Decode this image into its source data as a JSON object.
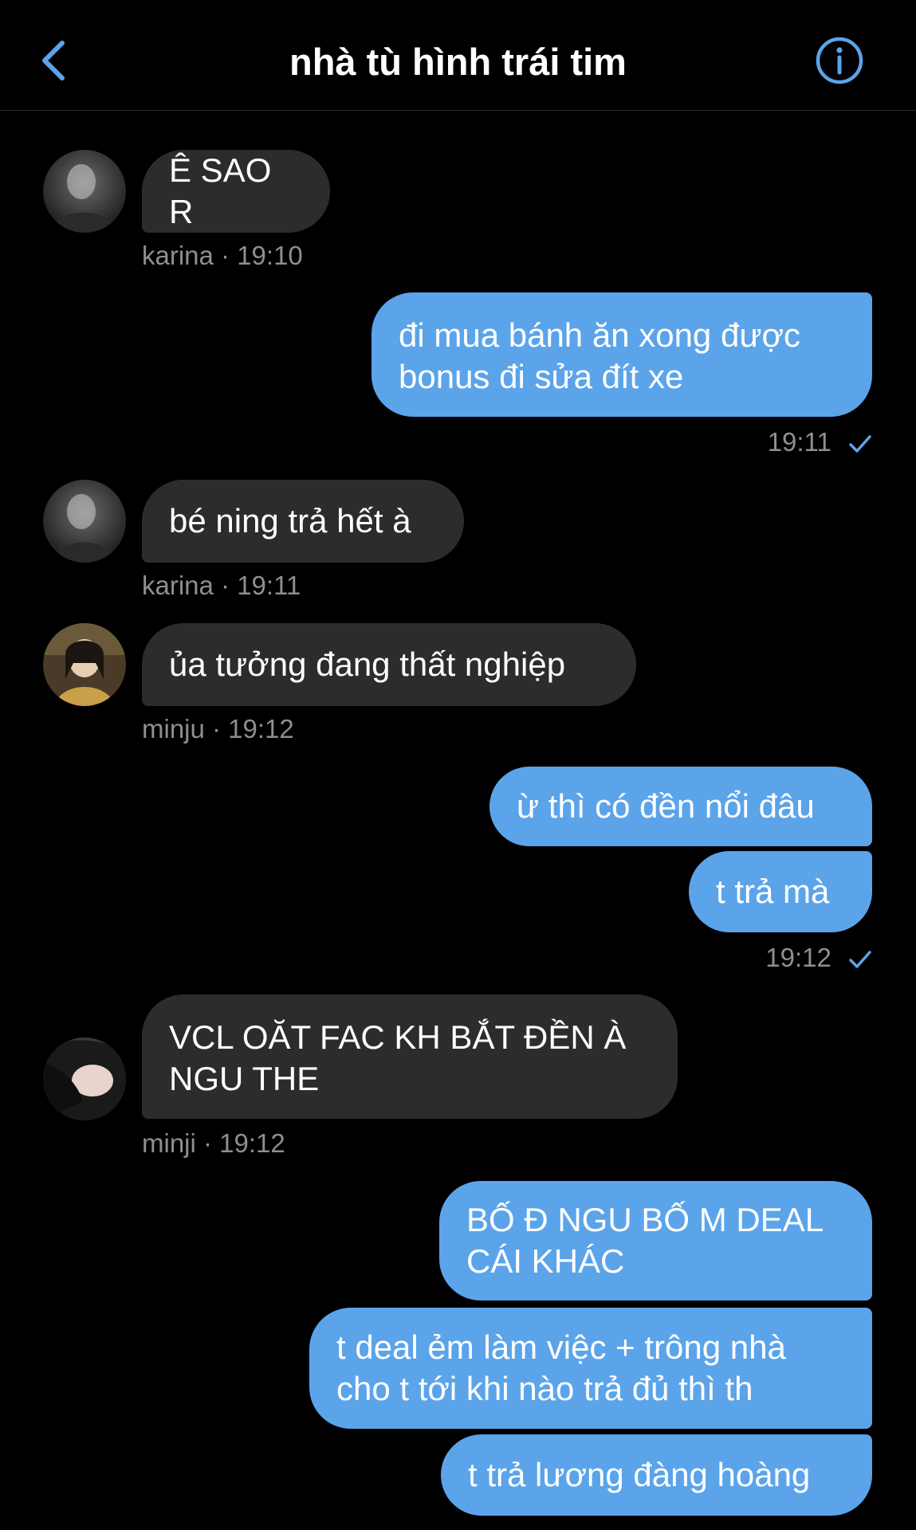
{
  "header": {
    "title": "nhà tù hình trái tim",
    "back_icon": "chevron-left-icon",
    "info_icon": "info-circle-icon",
    "accent": "#5ba4ea"
  },
  "messages": [
    {
      "side": "in",
      "sender": "karina",
      "time": "19:10",
      "text": "Ê SAO R"
    },
    {
      "side": "out",
      "time": "19:11",
      "text": "đi mua bánh ăn xong được bonus đi sửa đít xe"
    },
    {
      "side": "in",
      "sender": "karina",
      "time": "19:11",
      "text": "bé ning trả hết à"
    },
    {
      "side": "in",
      "sender": "minju",
      "time": "19:12",
      "text": "ủa tưởng đang thất nghiệp"
    },
    {
      "side": "out",
      "text": "ừ thì có đền nổi đâu"
    },
    {
      "side": "out",
      "time": "19:12",
      "text": "t trả mà"
    },
    {
      "side": "in",
      "sender": "minji",
      "time": "19:12",
      "text": "VCL OĂT FAC KH BẮT ĐỀN À NGU THE"
    },
    {
      "side": "out",
      "text": "BỐ Đ NGU BỐ M DEAL CÁI KHÁC"
    },
    {
      "side": "out",
      "text": "t deal ẻm làm việc + trông nhà cho t tới khi nào trả đủ thì th"
    },
    {
      "side": "out",
      "text": "t trả lương đàng hoàng"
    }
  ],
  "labels": {
    "karina_1": "karina · 19:10",
    "karina_2": "karina · 19:11",
    "minju_1": "minju · 19:12",
    "minji_1": "minji · 19:12",
    "out_time_1": "19:11",
    "out_time_2": "19:12"
  },
  "colors": {
    "incoming_bubble": "#2c2c2e",
    "outgoing_bubble": "#5ba4ea",
    "meta_text": "#8e8e93"
  }
}
